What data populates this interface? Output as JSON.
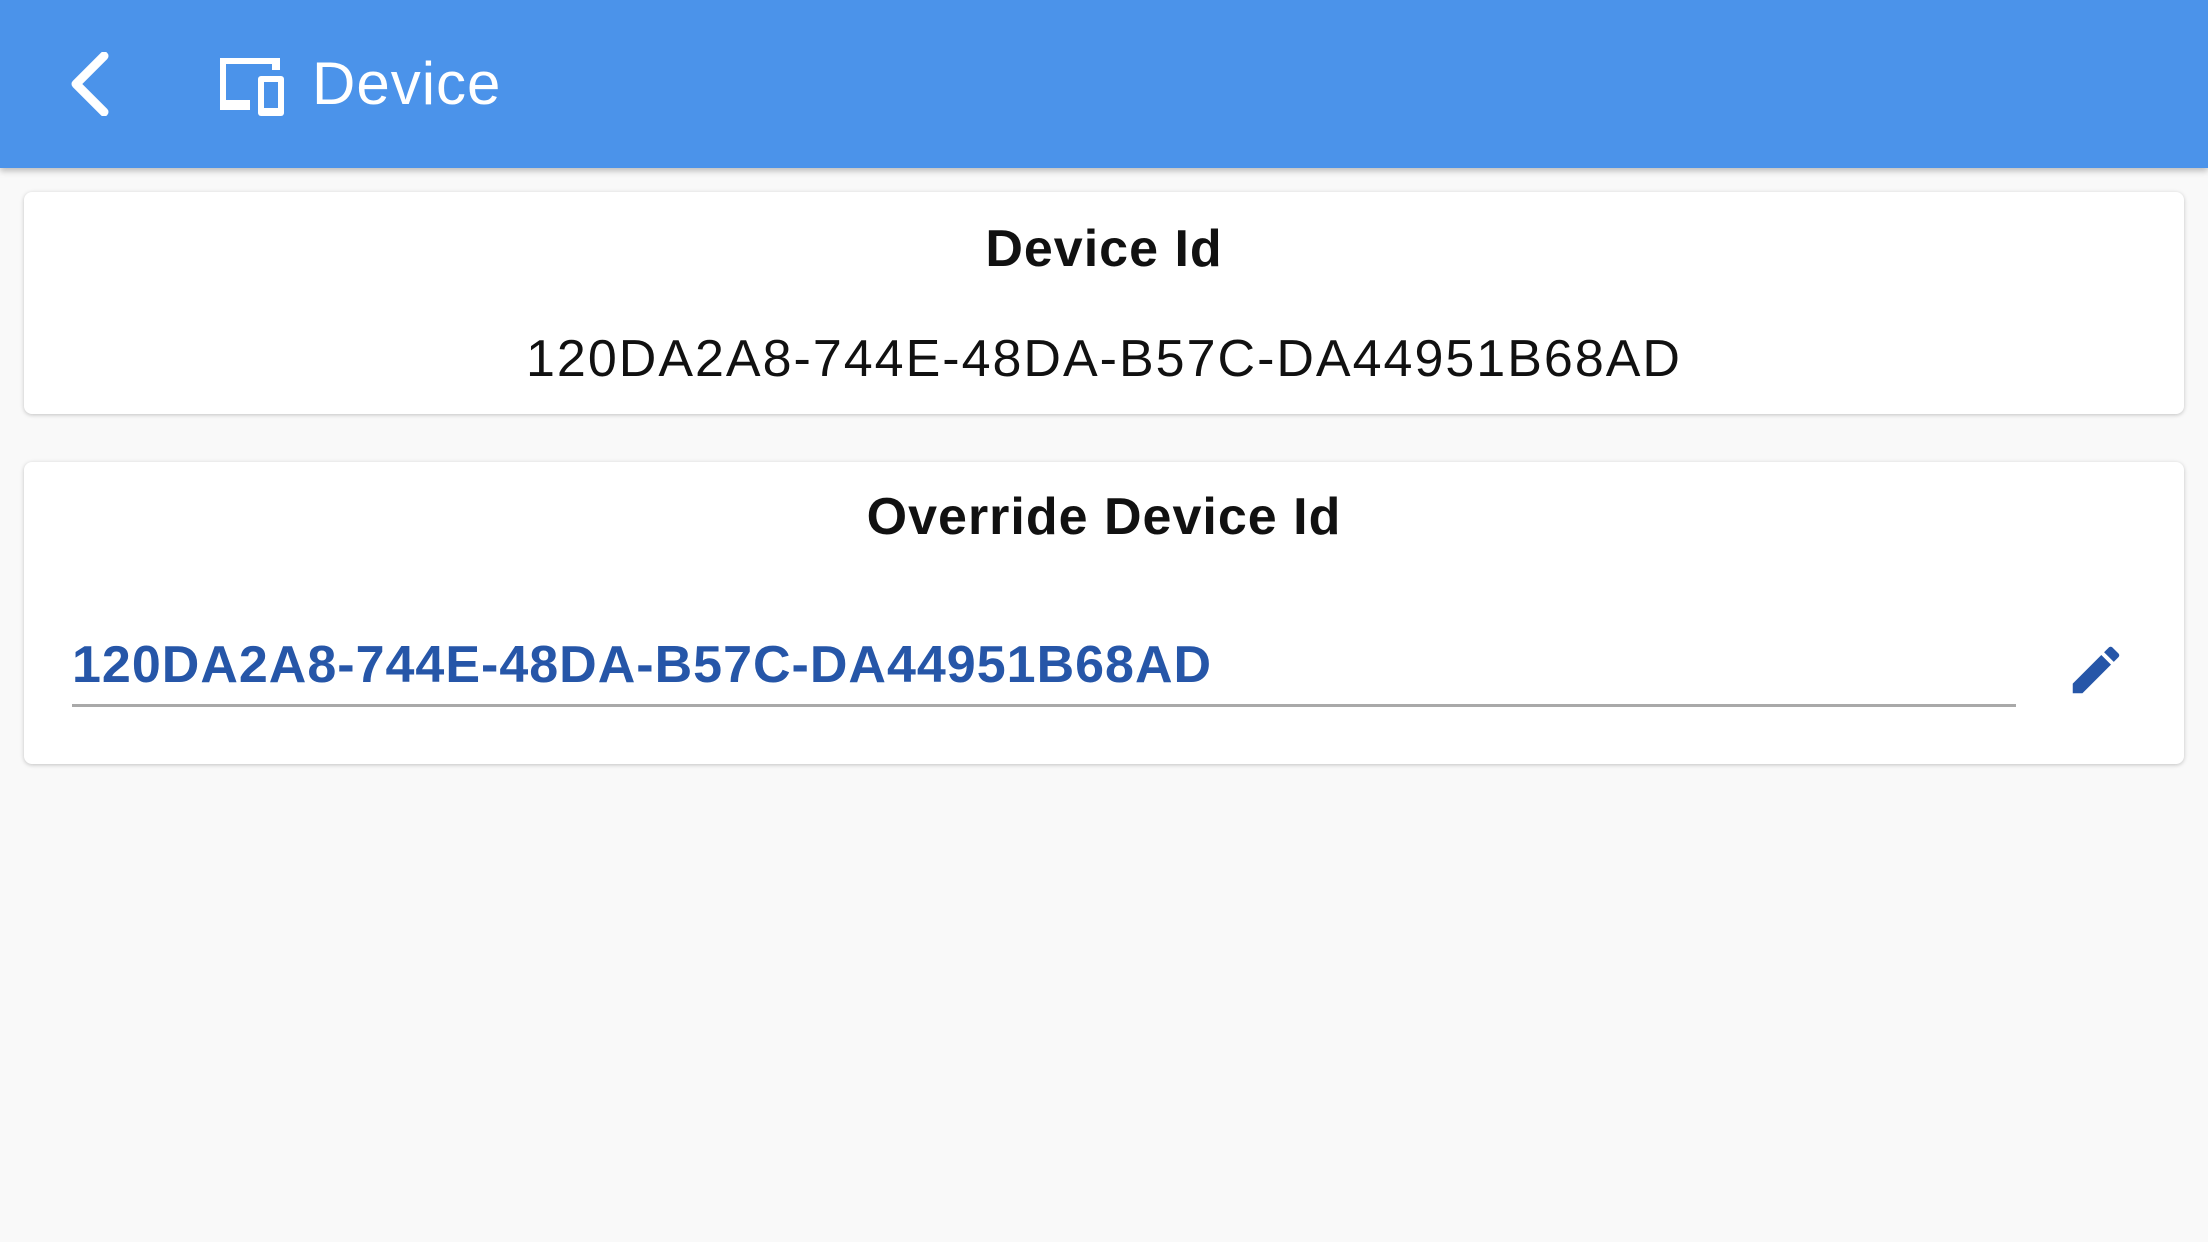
{
  "app_bar": {
    "title": "Device",
    "back_icon": "chevron-left-icon",
    "title_icon": "devices-icon",
    "background_color": "#4b93ea",
    "foreground_color": "#ffffff"
  },
  "device_id_card": {
    "title": "Device Id",
    "value": "120DA2A8-744E-48DA-B57C-DA44951B68AD"
  },
  "override_card": {
    "title": "Override Device Id",
    "input_value": "120DA2A8-744E-48DA-B57C-DA44951B68AD",
    "input_color": "#2656a8",
    "edit_icon": "pencil-icon"
  },
  "page_background": "#f9f9f9"
}
